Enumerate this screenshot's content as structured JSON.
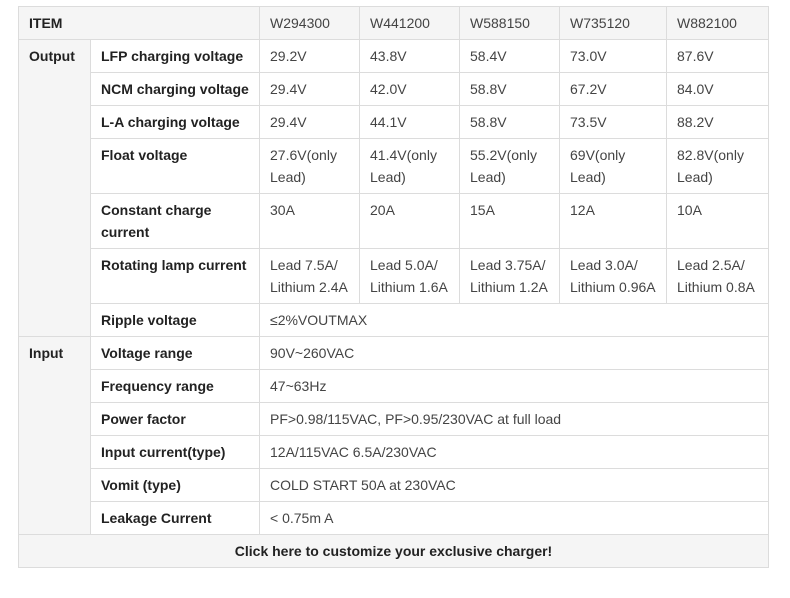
{
  "header": {
    "item": "ITEM",
    "models": [
      "W294300",
      "W441200",
      "W588150",
      "W735120",
      "W882100"
    ]
  },
  "groups": {
    "output": "Output",
    "input": "Input"
  },
  "output_rows": [
    {
      "label": "LFP charging voltage",
      "values": [
        "29.2V",
        "43.8V",
        "58.4V",
        "73.0V",
        "87.6V"
      ]
    },
    {
      "label": "NCM charging voltage",
      "values": [
        "29.4V",
        "42.0V",
        "58.8V",
        "67.2V",
        "84.0V"
      ]
    },
    {
      "label": "L-A charging voltage",
      "values": [
        "29.4V",
        "44.1V",
        "58.8V",
        "73.5V",
        "88.2V"
      ]
    },
    {
      "label": "Float voltage",
      "values": [
        "27.6V(only Lead)",
        "41.4V(only Lead)",
        "55.2V(only Lead)",
        "69V(only Lead)",
        "82.8V(only Lead)"
      ]
    },
    {
      "label": "Constant charge current",
      "values": [
        "30A",
        "20A",
        "15A",
        "12A",
        "10A"
      ]
    },
    {
      "label": "Rotating lamp current",
      "values": [
        "Lead 7.5A/ Lithium 2.4A",
        "Lead 5.0A/ Lithium 1.6A",
        "Lead 3.75A/ Lithium 1.2A",
        "Lead 3.0A/ Lithium 0.96A",
        "Lead 2.5A/ Lithium 0.8A"
      ]
    },
    {
      "label": "Ripple voltage",
      "value": "≤2%VOUTMAX"
    }
  ],
  "input_rows": [
    {
      "label": "Voltage range",
      "value": "90V~260VAC"
    },
    {
      "label": "Frequency range",
      "value": "47~63Hz"
    },
    {
      "label": "Power factor",
      "value": "PF>0.98/115VAC, PF>0.95/230VAC at full load"
    },
    {
      "label": "Input current(type)",
      "value": "12A/115VAC 6.5A/230VAC"
    },
    {
      "label": "Vomit (type)",
      "value": "COLD START 50A at 230VAC"
    },
    {
      "label": "Leakage Current",
      "value": " < 0.75m A"
    }
  ],
  "footer": {
    "cta": "Click here to customize your exclusive charger!"
  }
}
